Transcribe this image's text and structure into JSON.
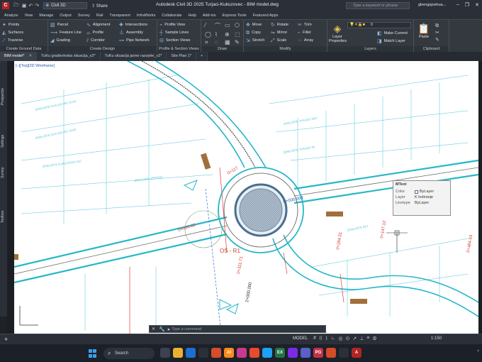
{
  "titlebar": {
    "app_logo": "C",
    "workspace": "Civil 3D",
    "share_label": "Share",
    "title": "Autodesk Civil 3D 2025   Turjaci-Kukuzovec - BIM model.dwg",
    "search_placeholder": "Type a keyword or phrase",
    "user": "gbengajoshua...",
    "window_buttons": [
      "–",
      "❐",
      "✕"
    ]
  },
  "menubar": {
    "items": [
      "Analyze",
      "View",
      "Manage",
      "Output",
      "Survey",
      "Rail",
      "Transparent",
      "InfraWorks",
      "Collaborate",
      "Help",
      "Add-ins",
      "Express Tools",
      "Featured Apps"
    ]
  },
  "ribbon": {
    "ground_data": {
      "items": [
        "Points",
        "Surfaces",
        "Traverse"
      ],
      "label": "Create Ground Data"
    },
    "design_a": {
      "items": [
        "Parcel",
        "Feature Line",
        "Grading"
      ]
    },
    "design_b": {
      "items": [
        "Alignment",
        "Profile",
        "Corridor"
      ]
    },
    "design_c": {
      "items": [
        "Intersections",
        "Assembly",
        "Pipe Network"
      ],
      "label": "Create Design"
    },
    "profile_views": {
      "items": [
        "Profile View",
        "Sample Lines",
        "Section Views"
      ],
      "label": "Profile & Section Views"
    },
    "draw": {
      "label": "Draw",
      "icons": [
        "⁄",
        "⌒",
        "▭",
        "⬡",
        "◯",
        "⌇",
        "⊕",
        "⬚",
        "⌗",
        "◌",
        "▦",
        "✎"
      ]
    },
    "modify_a": {
      "items": [
        "Move",
        "Copy",
        "Stretch"
      ]
    },
    "modify_b": {
      "items": [
        "Rotate",
        "Mirror",
        "Scale"
      ]
    },
    "modify_c": {
      "items": [
        "Trim",
        "Fillet",
        "Array"
      ],
      "label": "Modify"
    },
    "layers": {
      "big_button": "Layer Properties",
      "layer_value": "0",
      "items": [
        "Make Current",
        "Match Layer"
      ],
      "label": "Layers"
    },
    "clipboard": {
      "big_button": "Paste",
      "label": "Clipboard"
    }
  },
  "doctabs": [
    {
      "label": "BIM model*",
      "active": true
    },
    {
      "label": "TuKu građevinska situacija_v2*",
      "active": false
    },
    {
      "label": "TuKu situacija javne rasvjete_v2*",
      "active": false
    },
    {
      "label": "Site Plan 1*",
      "active": false
    },
    {
      "label": "+",
      "active": false
    }
  ],
  "palettes": [
    "Prospector",
    "Settings",
    "Survey",
    "Toolbox"
  ],
  "viewport": {
    "label": "[–][Top][2D Wireframe]",
    "texts": {
      "station_a": "0+000.000",
      "station_b": "0+284.51",
      "station_c": "0+147.12",
      "station_d": "0+484.63",
      "road_label": "OS - R1",
      "station_e": "2+000.000",
      "station_f": "0+311.71",
      "station_g": "0+000.00",
      "station_h": "0+117"
    }
  },
  "mtext_tooltip": {
    "title": "MText",
    "rows": [
      {
        "key": "Color",
        "value": "ByLayer",
        "swatch": "#ffffff"
      },
      {
        "key": "Layer",
        "value": "K kotiranje"
      },
      {
        "key": "Linetype",
        "value": "ByLayer"
      }
    ]
  },
  "commandline": {
    "placeholder": "Type a command"
  },
  "statusbar": {
    "model_label": "MODEL",
    "tool_icons": [
      "#",
      "⠿",
      "⌇",
      "∟",
      "◎",
      "⊙",
      "↗",
      "⊥",
      "≡",
      "⚙"
    ],
    "scale": "1:150"
  },
  "taskbar": {
    "search_label": "Search",
    "apps": [
      {
        "label": "",
        "color": "#3a4150"
      },
      {
        "label": "",
        "color": "#e8b230"
      },
      {
        "label": "",
        "color": "#1f6fd0"
      },
      {
        "label": "",
        "color": "#2a2f38"
      },
      {
        "label": "",
        "color": "#d84c2a"
      },
      {
        "label": "AI",
        "color": "#ff8a1d"
      },
      {
        "label": "",
        "color": "#c83a8e"
      },
      {
        "label": "",
        "color": "#e84a2f"
      },
      {
        "label": "",
        "color": "#1da1f2"
      },
      {
        "label": "EX",
        "color": "#217346"
      },
      {
        "label": "",
        "color": "#7d2ae8"
      },
      {
        "label": "",
        "color": "#5b5fc7"
      },
      {
        "label": "PG",
        "color": "#c4314b"
      },
      {
        "label": "",
        "color": "#d34b28"
      },
      {
        "label": "",
        "color": "#2b3038"
      },
      {
        "label": "A",
        "color": "#b22424"
      }
    ],
    "tray": "^"
  }
}
